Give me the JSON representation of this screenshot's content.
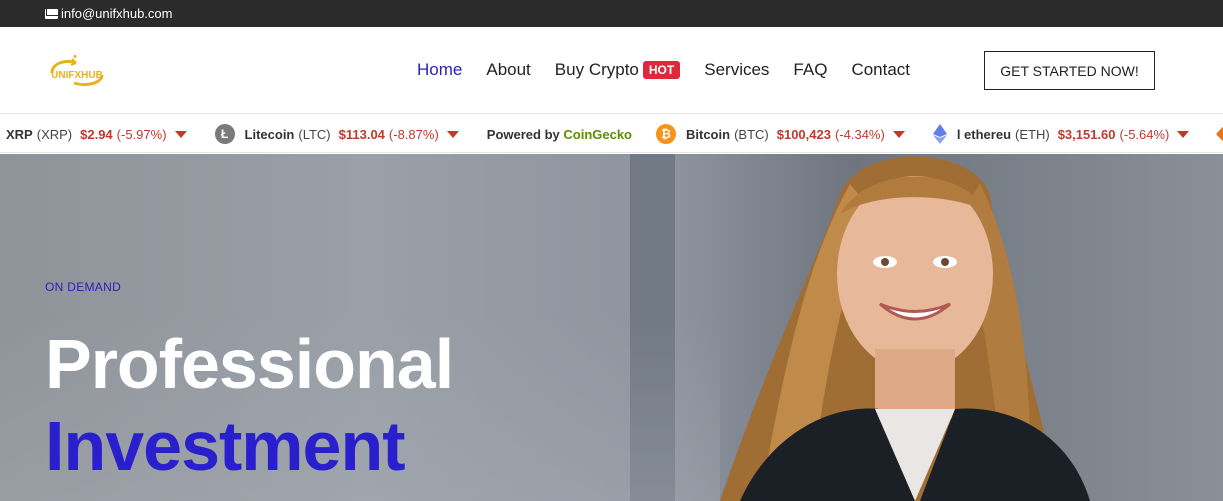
{
  "topbar": {
    "email": "info@unifxhub.com"
  },
  "header": {
    "logo_text": "UNIFXHUB",
    "nav": [
      {
        "label": "Home",
        "active": true
      },
      {
        "label": "About",
        "active": false
      },
      {
        "label": "Buy Crypto",
        "active": false,
        "badge": "HOT"
      },
      {
        "label": "Services",
        "active": false
      },
      {
        "label": "FAQ",
        "active": false
      },
      {
        "label": "Contact",
        "active": false
      }
    ],
    "cta": "GET STARTED NOW!"
  },
  "ticker": {
    "items": [
      {
        "name": "XRP",
        "symbol": "(XRP)",
        "price": "$2.94",
        "change": "(-5.97%)",
        "icon": "xrp-icon",
        "color": "#222222"
      },
      {
        "name": "Litecoin",
        "symbol": "(LTC)",
        "price": "$113.04",
        "change": "(-8.87%)",
        "icon": "litecoin-icon",
        "color": "#7a7a7a"
      },
      {
        "name": "Bitcoin",
        "symbol": "(BTC)",
        "price": "$100,423",
        "change": "(-4.34%)",
        "icon": "bitcoin-icon",
        "color": "#f7931a"
      },
      {
        "name": "l ethereu",
        "symbol": "(ETH)",
        "price": "$3,151.60",
        "change": "(-5.64%)",
        "icon": "ethereum-icon",
        "color": "#627eea"
      }
    ],
    "powered_prefix": "Powered by",
    "powered_brand": "CoinGecko"
  },
  "hero": {
    "eyebrow": "ON DEMAND",
    "title_line1": "Professional",
    "title_line2": "Investment"
  },
  "colors": {
    "accent": "#2a1fcc",
    "hot": "#e0283c",
    "down": "#c0392b",
    "topbar": "#2b2b2b"
  }
}
